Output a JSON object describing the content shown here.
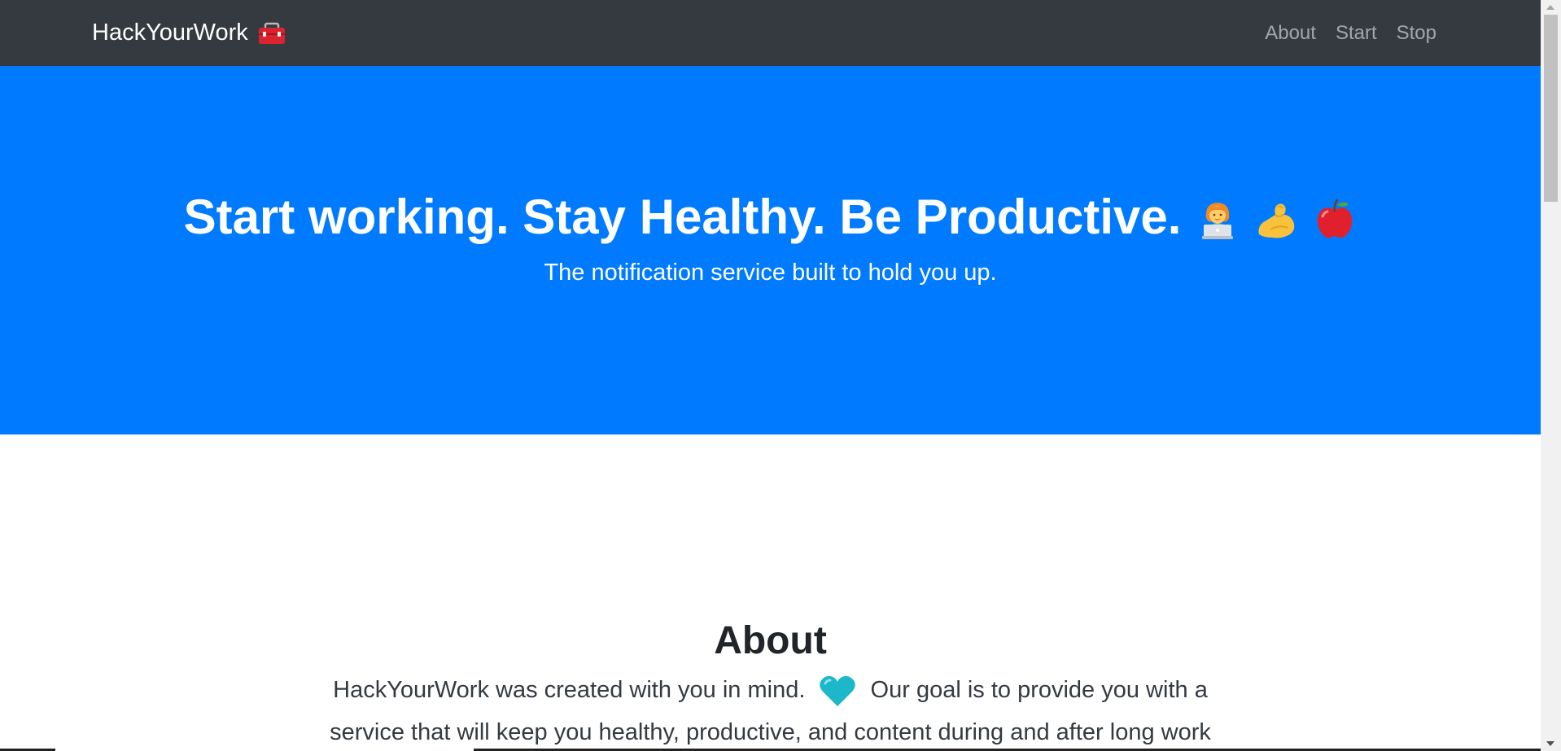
{
  "navbar": {
    "brand": "HackYourWork",
    "brand_icon": "toolbox-icon",
    "links": [
      {
        "label": "About"
      },
      {
        "label": "Start"
      },
      {
        "label": "Stop"
      }
    ],
    "background": "#343a40"
  },
  "hero": {
    "title": "Start working. Stay Healthy. Be Productive.",
    "emojis": [
      "person-laptop-icon",
      "flexed-biceps-icon",
      "red-apple-icon"
    ],
    "subtitle": "The notification service built to hold you up.",
    "background": "#007bff"
  },
  "about": {
    "title": "About",
    "text_before": "HackYourWork was created with you in mind.",
    "heart_icon": "blue-heart-icon",
    "text_after": "Our goal is to provide you with a service that will keep you healthy, productive, and content during and after long work"
  }
}
